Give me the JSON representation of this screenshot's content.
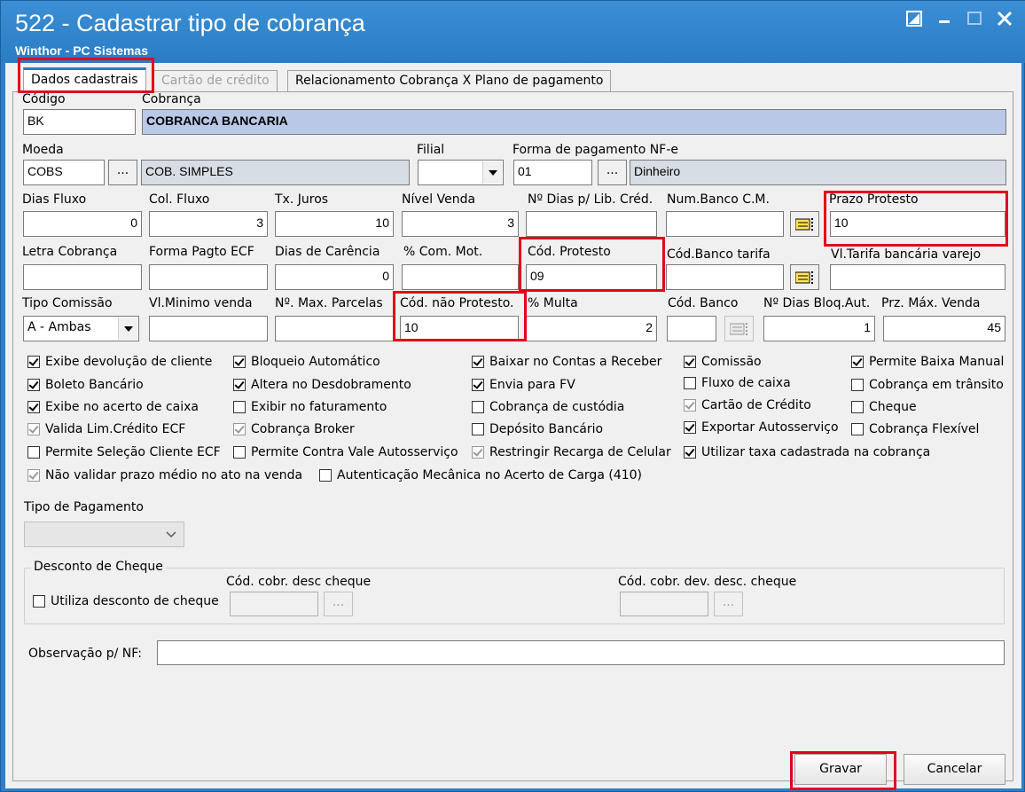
{
  "window": {
    "title": "522 - Cadastrar tipo de cobrança",
    "subtitle": "Winthor - PC Sistemas"
  },
  "tabs": [
    {
      "label": "Dados cadastrais",
      "state": "active"
    },
    {
      "label": "Cartão de crédito",
      "state": "disabled"
    },
    {
      "label": "Relacionamento Cobrança X Plano de pagamento",
      "state": "normal"
    }
  ],
  "fields": {
    "codigo": {
      "label": "Código",
      "value": "BK"
    },
    "cobranca": {
      "label": "Cobrança",
      "value": "COBRANCA BANCARIA"
    },
    "moeda": {
      "label": "Moeda",
      "value": "COBS",
      "desc": "COB. SIMPLES"
    },
    "filial": {
      "label": "Filial",
      "value": ""
    },
    "forma_pag_nfe": {
      "label": "Forma de pagamento NF-e",
      "value": "01",
      "desc": "Dinheiro"
    },
    "dias_fluxo": {
      "label": "Dias Fluxo",
      "value": "0"
    },
    "col_fluxo": {
      "label": "Col. Fluxo",
      "value": "3"
    },
    "tx_juros": {
      "label": "Tx. Juros",
      "value": "10"
    },
    "nivel_venda": {
      "label": "Nível Venda",
      "value": "3"
    },
    "nro_dias_lib": {
      "label": "Nº Dias p/ Lib. Créd.",
      "value": ""
    },
    "num_banco_cm": {
      "label": "Num.Banco C.M.",
      "value": ""
    },
    "prazo_protesto": {
      "label": "Prazo Protesto",
      "value": "10"
    },
    "letra_cobranca": {
      "label": "Letra Cobrança",
      "value": ""
    },
    "forma_pagto_ecf": {
      "label": "Forma Pagto ECF",
      "value": ""
    },
    "dias_carencia": {
      "label": "Dias de Carência",
      "value": "0"
    },
    "com_mot": {
      "label": "% Com. Mot.",
      "value": ""
    },
    "cod_protesto": {
      "label": "Cód. Protesto",
      "value": "09"
    },
    "cod_banco_tarifa": {
      "label": "Cód.Banco tarifa",
      "value": ""
    },
    "vl_tarifa": {
      "label": "Vl.Tarifa bancária varejo",
      "value": ""
    },
    "tipo_comissao": {
      "label": "Tipo Comissão",
      "value": "A - Ambas"
    },
    "vl_minimo_venda": {
      "label": "Vl.Minimo venda",
      "value": ""
    },
    "max_parcelas": {
      "label": "Nº. Max. Parcelas",
      "value": ""
    },
    "cod_nao_protesto": {
      "label": "Cód. não Protesto.",
      "value": "10"
    },
    "multa": {
      "label": "% Multa",
      "value": "2"
    },
    "cod_banco": {
      "label": "Cód. Banco",
      "value": ""
    },
    "nro_dias_bloq": {
      "label": "Nº Dias Bloq.Aut.",
      "value": "1"
    },
    "prz_max_venda": {
      "label": "Prz. Máx. Venda",
      "value": "45"
    }
  },
  "checkboxes": [
    {
      "label": "Exibe devolução de cliente",
      "checked": true,
      "enabled": true
    },
    {
      "label": "Bloqueio Automático",
      "checked": true,
      "enabled": true
    },
    {
      "label": "Baixar no Contas a Receber",
      "checked": true,
      "enabled": true
    },
    {
      "label": "Comissão",
      "checked": true,
      "enabled": true
    },
    {
      "label": "Permite Baixa Manual",
      "checked": true,
      "enabled": true
    },
    {
      "label": "Boleto Bancário",
      "checked": true,
      "enabled": true
    },
    {
      "label": "Altera no Desdobramento",
      "checked": true,
      "enabled": true
    },
    {
      "label": "Envia para FV",
      "checked": true,
      "enabled": true
    },
    {
      "label": "Fluxo de caixa",
      "checked": false,
      "enabled": true
    },
    {
      "label": "Cobrança em trânsito",
      "checked": false,
      "enabled": true
    },
    {
      "label": "Exibe no acerto de caixa",
      "checked": true,
      "enabled": true
    },
    {
      "label": "Exibir no faturamento",
      "checked": false,
      "enabled": true
    },
    {
      "label": "Cobrança de custódia",
      "checked": false,
      "enabled": true
    },
    {
      "label": "Cartão de Crédito",
      "checked": true,
      "enabled": false
    },
    {
      "label": "Cheque",
      "checked": false,
      "enabled": true
    },
    {
      "label": "Valida Lim.Crédito ECF",
      "checked": true,
      "enabled": false
    },
    {
      "label": "Cobrança Broker",
      "checked": true,
      "enabled": false
    },
    {
      "label": "Depósito Bancário",
      "checked": false,
      "enabled": true
    },
    {
      "label": "Exportar Autosserviço",
      "checked": true,
      "enabled": true
    },
    {
      "label": "Cobrança Flexível",
      "checked": false,
      "enabled": true
    },
    {
      "label": "Permite Seleção Cliente ECF",
      "checked": false,
      "enabled": true
    },
    {
      "label": "Permite Contra Vale Autosserviço",
      "checked": false,
      "enabled": true
    },
    {
      "label": "Restringir Recarga de Celular",
      "checked": true,
      "enabled": false
    },
    {
      "label": "Utilizar taxa cadastrada na cobrança",
      "checked": true,
      "enabled": true
    },
    {
      "label": "Não validar prazo médio no ato na venda",
      "checked": true,
      "enabled": false
    },
    {
      "label": "Autenticação Mecânica no Acerto de Carga (410)",
      "checked": false,
      "enabled": true
    }
  ],
  "tipo_pagamento": {
    "label": "Tipo de Pagamento",
    "value": ""
  },
  "desconto_cheque": {
    "group_label": "Desconto de Cheque",
    "utiliza_label": "Utiliza desconto de cheque",
    "cod_cobr_label": "Cód. cobr. desc cheque",
    "cod_cobr_dev_label": "Cód. cobr. dev. desc. cheque"
  },
  "observacao": {
    "label": "Observação p/ NF:",
    "value": ""
  },
  "buttons": {
    "ellipsis": "...",
    "gravar": "Gravar",
    "cancelar": "Cancelar"
  },
  "colors": {
    "title_bar": "#2a7cc4",
    "highlight": "#e3001b",
    "readonly": "#d6dde4",
    "cobranca_bg": "#b8c8e6"
  }
}
